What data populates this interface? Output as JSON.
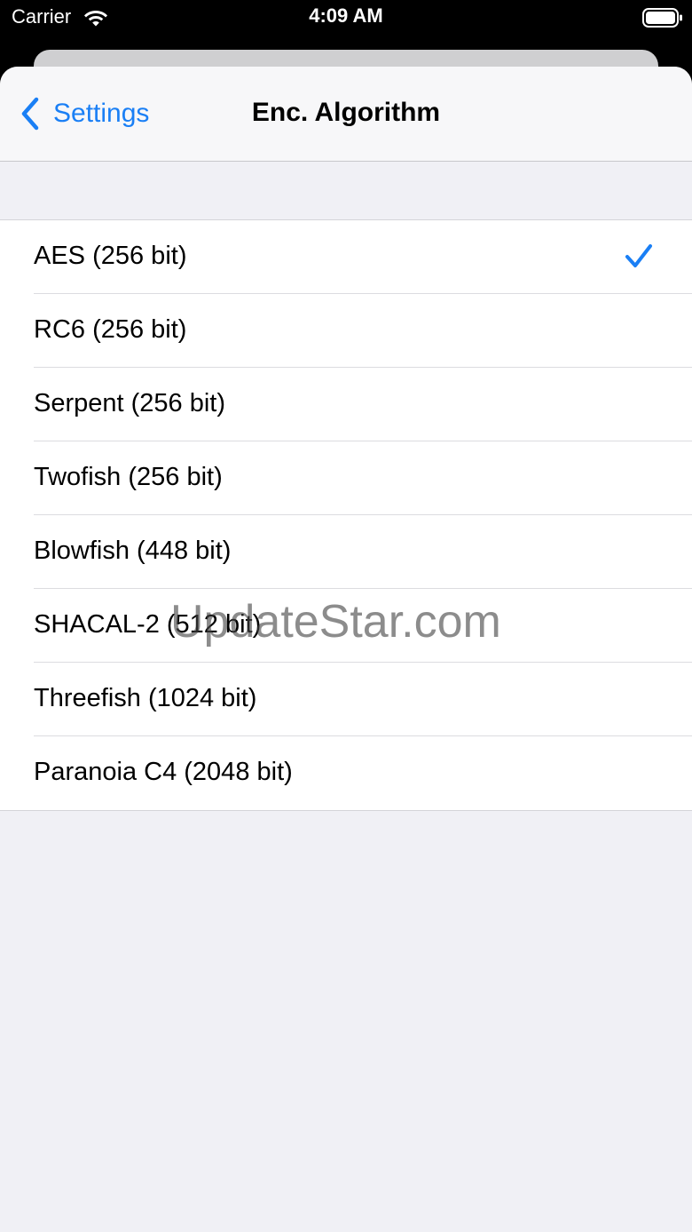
{
  "status_bar": {
    "carrier": "Carrier",
    "time": "4:09 AM",
    "icons": [
      "wifi-icon",
      "battery-icon"
    ]
  },
  "nav": {
    "back_label": "Settings",
    "back_icon": "chevron-left-icon",
    "title": "Enc. Algorithm"
  },
  "algorithms": {
    "items": [
      {
        "label": "AES (256 bit)",
        "selected": true
      },
      {
        "label": "RC6 (256 bit)",
        "selected": false
      },
      {
        "label": "Serpent (256 bit)",
        "selected": false
      },
      {
        "label": "Twofish (256 bit)",
        "selected": false
      },
      {
        "label": "Blowfish (448 bit)",
        "selected": false
      },
      {
        "label": "SHACAL-2 (512 bit)",
        "selected": false
      },
      {
        "label": "Threefish (1024 bit)",
        "selected": false
      },
      {
        "label": "Paranoia C4 (2048 bit)",
        "selected": false
      }
    ],
    "checkmark_icon": "checkmark-icon"
  },
  "watermark": "UpdateStar.com",
  "colors": {
    "accent": "#1a7ff5",
    "background": "#f0f0f5",
    "row_background": "#ffffff"
  }
}
